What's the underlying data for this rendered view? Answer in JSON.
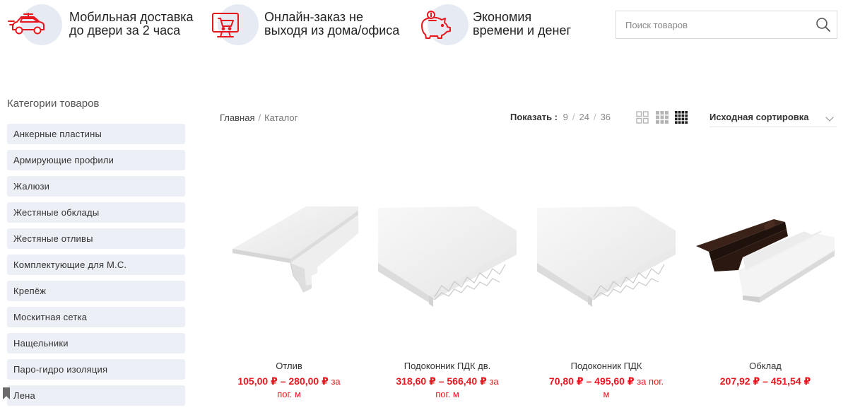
{
  "features": [
    {
      "icon": "delivery-car-icon",
      "line1": "Мобильная доставка",
      "line2": "до двери за 2 часа"
    },
    {
      "icon": "online-cart-icon",
      "line1": "Онлайн-заказ не",
      "line2": "выходя из дома/офиса"
    },
    {
      "icon": "piggy-bank-icon",
      "line1": "Экономия",
      "line2": "времени и денег"
    }
  ],
  "search": {
    "placeholder": "Поиск товаров",
    "value": "",
    "icon": "search-icon"
  },
  "sidebar": {
    "title": "Категории товаров",
    "items": [
      {
        "label": "Анкерные пластины"
      },
      {
        "label": "Армирующие профили"
      },
      {
        "label": "Жалюзи"
      },
      {
        "label": "Жестяные обклады"
      },
      {
        "label": "Жестяные отливы"
      },
      {
        "label": "Комплектующие для М.С."
      },
      {
        "label": "Крепёж"
      },
      {
        "label": "Москитная сетка"
      },
      {
        "label": "Нащельники"
      },
      {
        "label": "Паро-гидро изоляция"
      },
      {
        "label": "Лена"
      }
    ]
  },
  "breadcrumb": {
    "home": "Главная",
    "separator": "/",
    "current": "Каталог"
  },
  "show": {
    "label": "Показать :",
    "options": [
      "9",
      "24",
      "36"
    ],
    "separator": "/"
  },
  "view_modes": [
    "grid-2-icon",
    "grid-3-icon",
    "grid-4-icon"
  ],
  "active_view": "grid-4-icon",
  "sort": {
    "selected": "Исходная сортировка"
  },
  "products": [
    {
      "name": "Отлив",
      "price": "105,00 ₽ – 280,00 ₽",
      "unit_line1": " за",
      "unit_line2": "пог. м"
    },
    {
      "name": "Подоконник ПДК дв.",
      "price": "318,60 ₽ – 566,40 ₽",
      "unit_line1": " за",
      "unit_line2": "пог. м"
    },
    {
      "name": "Подоконник ПДК",
      "price": "70,80 ₽ – 495,60 ₽",
      "unit_line1": " за пог.",
      "unit_line2": "м"
    },
    {
      "name": "Обклад",
      "price": "207,92 ₽ – 451,54 ₽",
      "unit_line1": "",
      "unit_line2": ""
    }
  ],
  "colors": {
    "accent": "#e8171f",
    "feature_circle": "#e6ebf3",
    "category_bg": "#eceff5",
    "price": "#e8171f"
  }
}
